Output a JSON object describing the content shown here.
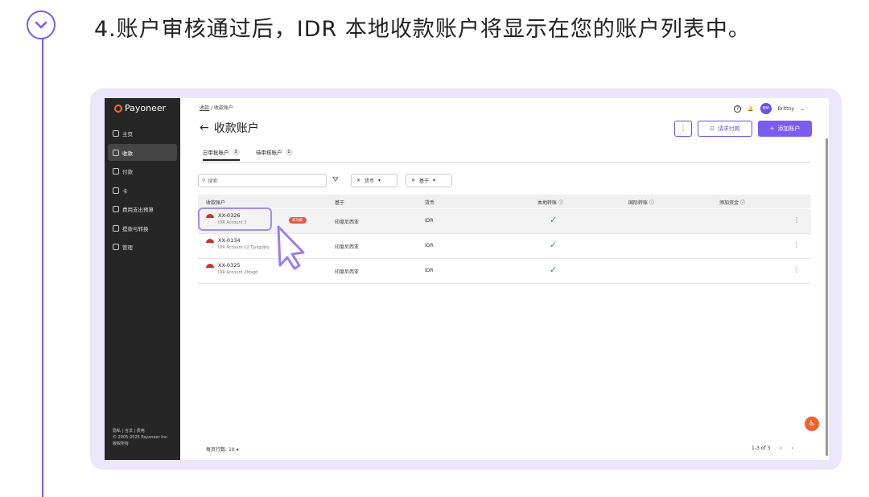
{
  "step": {
    "title": "4.账户审核通过后，IDR 本地收款账户将显示在您的账户列表中。"
  },
  "brand": {
    "name": "Payoneer",
    "accent": "#7b5cf0",
    "logo_color": "#ff6a2c"
  },
  "sidebar": {
    "items": [
      {
        "label": "主页",
        "icon": "home-icon"
      },
      {
        "label": "收款",
        "icon": "inbox-icon"
      },
      {
        "label": "付款",
        "icon": "payment-icon"
      },
      {
        "label": "卡",
        "icon": "card-icon"
      },
      {
        "label": "费用支出预算",
        "icon": "budget-icon"
      },
      {
        "label": "提款与转换",
        "icon": "withdraw-icon"
      },
      {
        "label": "管理",
        "icon": "menu-icon"
      }
    ],
    "footer": {
      "links": "隐私 | 合法 | 费用",
      "copyright": "© 2005-2025 Payoneer Inc.",
      "rights": "版权所有"
    }
  },
  "header": {
    "breadcrumb_root": "收款",
    "breadcrumb_sep": "/",
    "breadcrumb_current": "收款账户",
    "title": "收款账户",
    "user_name": "Brittny",
    "avatar_initials": "BM",
    "request_button": "请求付款",
    "add_button": "添加账户"
  },
  "tabs": [
    {
      "label": "已审批账户",
      "count": "3"
    },
    {
      "label": "待审核账户",
      "count": "1"
    }
  ],
  "filters": {
    "search_placeholder": "搜索",
    "currency_chip": "货币",
    "base_chip": "基于"
  },
  "table": {
    "columns": [
      "收款账户",
      "基于",
      "货币",
      "本地转账",
      "国际转账",
      "添加资金"
    ],
    "rows": [
      {
        "account": "XX-0326",
        "name": "IDR Account 3",
        "badge": "新功能",
        "based": "印度尼西亚",
        "currency": "IDR",
        "local": "✓"
      },
      {
        "account": "XX-0134",
        "name": "IDR Account 12 Tjykgdjky",
        "based": "印度尼西亚",
        "currency": "IDR",
        "local": "✓"
      },
      {
        "account": "XX-0325",
        "name": "IDR Account 2fdsgd",
        "based": "印度尼西亚",
        "currency": "IDR",
        "local": "✓"
      }
    ]
  },
  "pagination": {
    "rows_label": "每页行数:",
    "rows_value": "10",
    "range": "1-3 of 3"
  }
}
